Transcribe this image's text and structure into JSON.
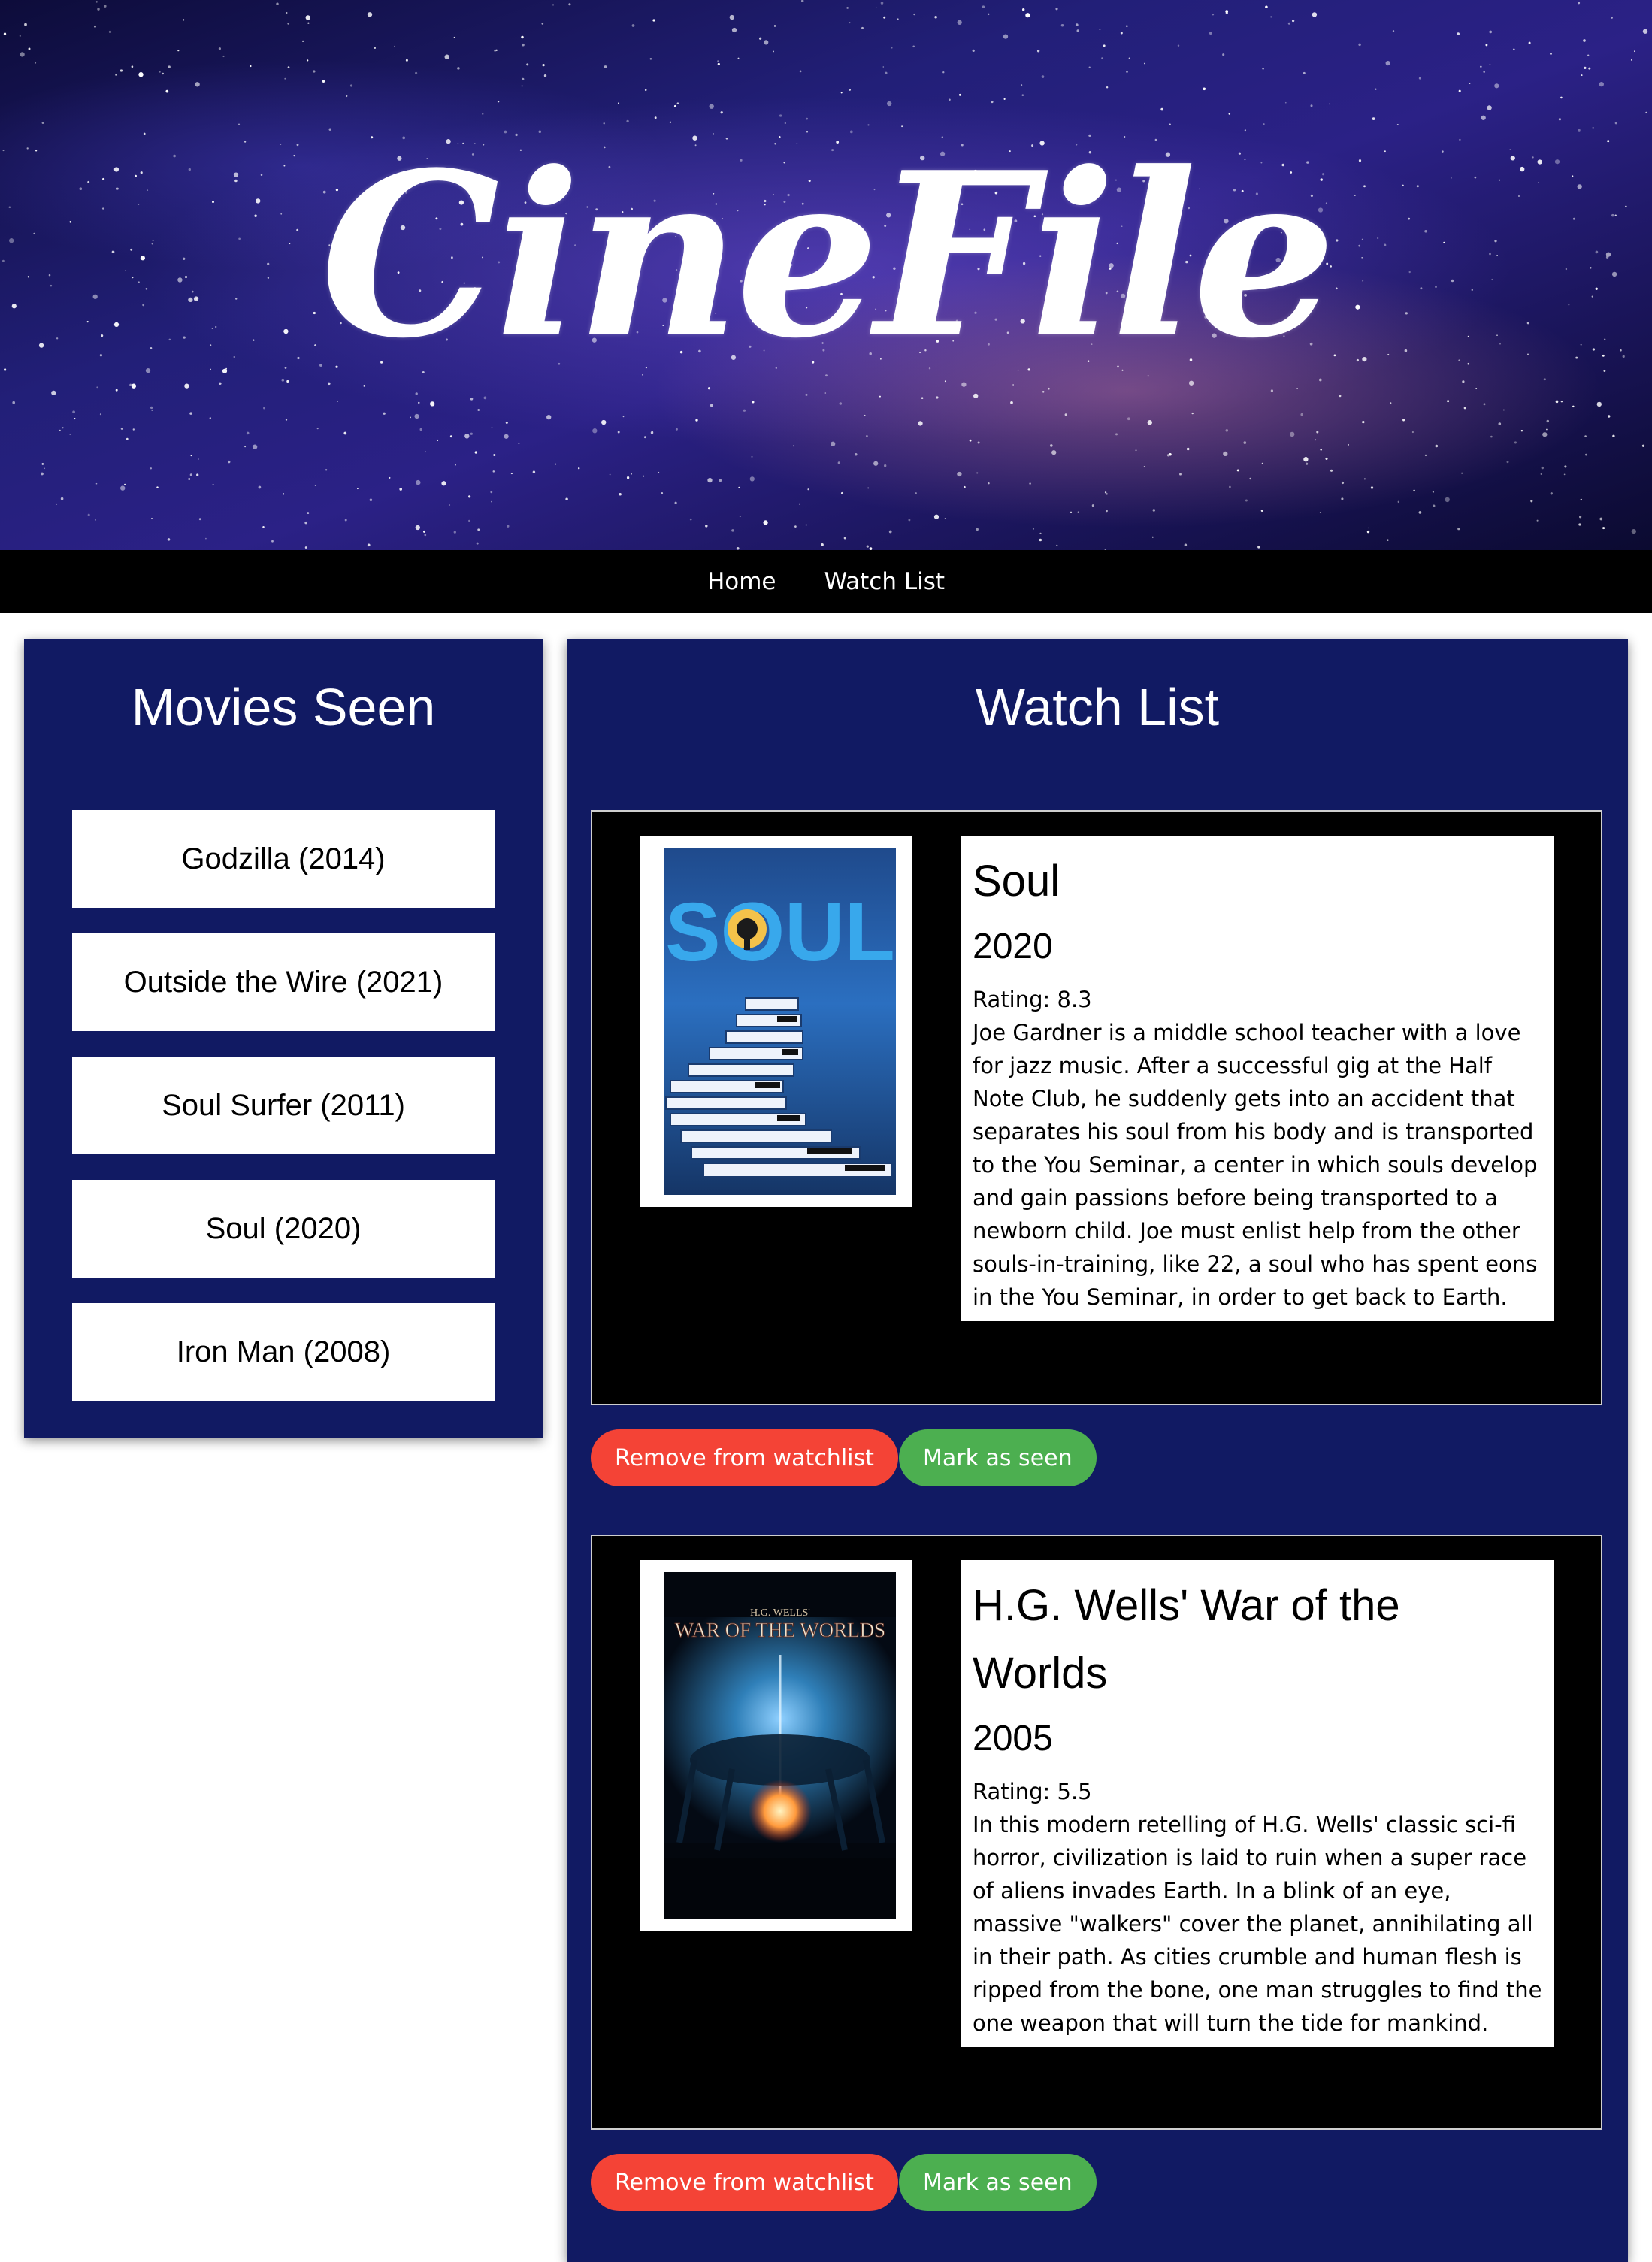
{
  "site": {
    "logo_text": "CineFile"
  },
  "nav": {
    "items": [
      {
        "label": "Home"
      },
      {
        "label": "Watch List"
      }
    ]
  },
  "seen_panel": {
    "title": "Movies Seen",
    "items": [
      {
        "label": "Godzilla (2014)"
      },
      {
        "label": "Outside the Wire (2021)"
      },
      {
        "label": "Soul Surfer (2011)"
      },
      {
        "label": "Soul (2020)"
      },
      {
        "label": "Iron Man (2008)"
      }
    ]
  },
  "watch_panel": {
    "title": "Watch List",
    "movies": [
      {
        "title": "Soul",
        "year": "2020",
        "rating": "Rating: 8.3",
        "description": "Joe Gardner is a middle school teacher with a love for jazz music. After a successful gig at the Half Note Club, he suddenly gets into an accident that separates his soul from his body and is transported to the You Seminar, a center in which souls develop and gain passions before being transported to a newborn child. Joe must enlist help from the other souls-in-training, like 22, a soul who has spent eons in the You Seminar, in order to get back to Earth.",
        "poster_text": "SOUL",
        "remove_label": "Remove from watchlist",
        "seen_label": "Mark as seen"
      },
      {
        "title": "H.G. Wells' War of the Worlds",
        "year": "2005",
        "rating": "Rating: 5.5",
        "description": "In this modern retelling of H.G. Wells' classic sci-fi horror, civilization is laid to ruin when a super race of aliens invades Earth. In a blink of an eye, massive \"walkers\" cover the planet, annihilating all in their path. As cities crumble and human flesh is ripped from the bone, one man struggles to find the one weapon that will turn the tide for mankind.",
        "poster_text_top": "H.G. WELLS'",
        "poster_text_main": "WAR OF THE WORLDS",
        "remove_label": "Remove from watchlist",
        "seen_label": "Mark as seen"
      }
    ]
  },
  "colors": {
    "panel_bg": "#111a63",
    "nav_bg": "#000000",
    "remove_button": "#f44336",
    "seen_button": "#4caf50"
  }
}
